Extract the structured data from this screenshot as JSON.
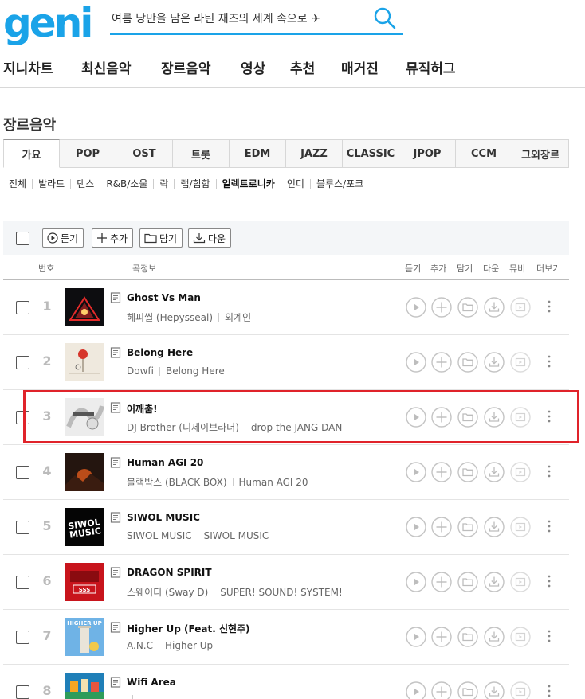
{
  "brand": {
    "logo_text": "genie",
    "logo_color": "#1aa3e8"
  },
  "search": {
    "value": "여름 낭만을 담은 라틴 재즈의 세계 속으로 ✈"
  },
  "gnb": [
    "지니차트",
    "최신음악",
    "장르음악",
    "영상",
    "추천",
    "매거진",
    "뮤직허그"
  ],
  "section_title": "장르음악",
  "genre_tabs": [
    "가요",
    "POP",
    "OST",
    "트롯",
    "EDM",
    "JAZZ",
    "CLASSIC",
    "JPOP",
    "CCM",
    "그외장르"
  ],
  "active_tab": "가요",
  "subgenres": [
    "전체",
    "발라드",
    "댄스",
    "R&B/소울",
    "락",
    "랩/힙합",
    "일렉트로니카",
    "인디",
    "블루스/포크"
  ],
  "active_subgenre": "일렉트로니카",
  "toolbar": {
    "play": "듣기",
    "add": "추가",
    "save": "담기",
    "download": "다운"
  },
  "columns": {
    "number": "번호",
    "info": "곡정보",
    "play": "듣기",
    "add": "추가",
    "save": "담기",
    "download": "다운",
    "mv": "뮤비",
    "more": "더보기"
  },
  "songs": [
    {
      "rank": "1",
      "title": "Ghost Vs Man",
      "artist": "헤피씰 (Hepysseal)",
      "album": "외계인",
      "cover": "#0d0d10",
      "cover_accent": "#e42a2a"
    },
    {
      "rank": "2",
      "title": "Belong Here",
      "artist": "Dowfi",
      "album": "Belong Here",
      "cover": "#efe9de",
      "cover_accent": "#d6362c"
    },
    {
      "rank": "3",
      "title": "어깨춤!",
      "artist": "DJ Brother (디제이브라더)",
      "album": "drop the JANG DAN",
      "cover": "#ececec",
      "cover_accent": "#8a8a8a"
    },
    {
      "rank": "4",
      "title": "Human AGI 20",
      "artist": "블랙박스 (BLACK BOX)",
      "album": "Human AGI 20",
      "cover": "#24150f",
      "cover_accent": "#e05a1c"
    },
    {
      "rank": "5",
      "title": "SIWOL MUSIC",
      "artist": "SIWOL MUSIC",
      "album": "SIWOL MUSIC",
      "cover": "#050505",
      "cover_accent": "#ffffff"
    },
    {
      "rank": "6",
      "title": "DRAGON SPIRIT",
      "artist": "스웨이디 (Sway D)",
      "album": "SUPER! SOUND! SYSTEM!",
      "cover": "#c8141c",
      "cover_accent": "#ffffff"
    },
    {
      "rank": "7",
      "title": "Higher Up (Feat. 신현주)",
      "artist": "A.N.C",
      "album": "Higher Up",
      "cover": "#6fb3e6",
      "cover_accent": "#f2c94a"
    },
    {
      "rank": "8",
      "title": "Wifi Area",
      "artist": "",
      "album": "",
      "cover": "#1f7fb8",
      "cover_accent": "#f6a623"
    }
  ],
  "highlight_color": "#e0232a"
}
